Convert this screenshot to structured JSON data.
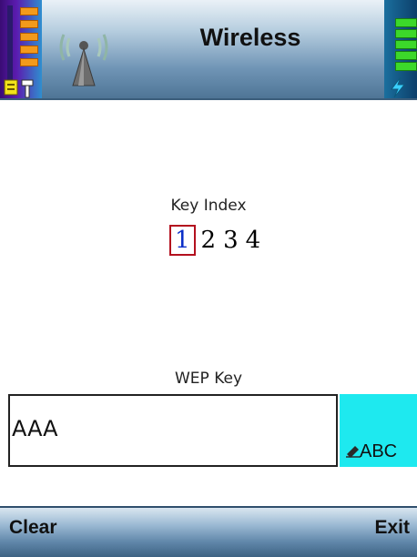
{
  "header": {
    "title": "Wireless",
    "app_icon": "antenna-icon",
    "signal": {
      "icon": "signal-strength-icon",
      "level": 0.75
    },
    "battery": {
      "icon": "battery-icon",
      "level": 0.9,
      "charging": true
    }
  },
  "key_index": {
    "label": "Key Index",
    "options": [
      "1",
      "2",
      "3",
      "4"
    ],
    "selected": "1"
  },
  "wep_key": {
    "label": "WEP Key",
    "value": "AAA",
    "input_mode": "ABC",
    "input_mode_icon": "pen-icon"
  },
  "softkeys": {
    "left": "Clear",
    "right": "Exit"
  },
  "colors": {
    "header_accent": "#6f94b5",
    "input_mode_bg": "#1ee9ef",
    "selection_border": "#b3101e",
    "selected_text": "#0b2fc8"
  }
}
